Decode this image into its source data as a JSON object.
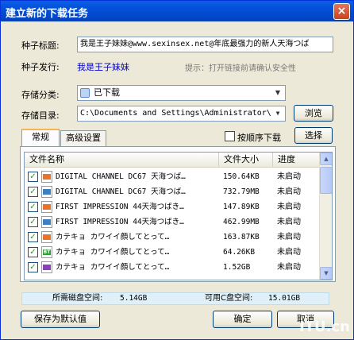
{
  "window": {
    "title": "建立新的下载任务",
    "close_glyph": "×"
  },
  "form": {
    "seed_title_label": "种子标题:",
    "seed_title_value": "我是王子妹妹@www.sexinsex.net@年底最强力的新人天海つば",
    "seed_publisher_label": "种子发行:",
    "seed_publisher_value": "我是王子妹妹",
    "hint": "提示：打开链接前请确认安全性",
    "category_label": "存储分类:",
    "category_value": "已下载",
    "directory_label": "存储目录:",
    "directory_value": "C:\\Documents and Settings\\Administrator\\",
    "browse_label": "浏览"
  },
  "tabs": [
    {
      "label": "常规",
      "active": true
    },
    {
      "label": "高级设置",
      "active": false
    }
  ],
  "sequential_label": "按顺序下载",
  "select_label": "选择",
  "file_list": {
    "columns": [
      "文件名称",
      "文件大小",
      "进度"
    ],
    "rows": [
      {
        "name": "DIGITAL CHANNEL DC67 天海つば…",
        "size": "150.64KB",
        "progress": "未启动",
        "icon": "image-file-icon",
        "color": "#e7732c",
        "tag": ""
      },
      {
        "name": "DIGITAL CHANNEL DC67 天海つば…",
        "size": "732.79MB",
        "progress": "未启动",
        "icon": "video-file-icon",
        "color": "#3f7fbf",
        "tag": ""
      },
      {
        "name": "FIRST IMPRESSION 44天海つばき…",
        "size": "147.89KB",
        "progress": "未启动",
        "icon": "image-file-icon",
        "color": "#e7732c",
        "tag": ""
      },
      {
        "name": "FIRST IMPRESSION 44天海つばき…",
        "size": "462.99MB",
        "progress": "未启动",
        "icon": "video-file-icon",
        "color": "#3f7fbf",
        "tag": ""
      },
      {
        "name": "カテキョ カワイイ顔してとって…",
        "size": "163.87KB",
        "progress": "未启动",
        "icon": "image-file-icon",
        "color": "#e7732c",
        "tag": ""
      },
      {
        "name": "カテキョ カワイイ顔してとって…",
        "size": "64.26KB",
        "progress": "未启动",
        "icon": "bt-file-icon",
        "color": "#2e9e3a",
        "tag": "BT"
      },
      {
        "name": "カテキョ カワイイ顔してとって…",
        "size": "1.52GB",
        "progress": "未启动",
        "icon": "video-file-icon",
        "color": "#8a3fbf",
        "tag": ""
      }
    ]
  },
  "status": {
    "disk_needed_label": "所需磁盘空间:",
    "disk_needed_value": "5.14GB",
    "c_free_label": "可用C盘空间:",
    "c_free_value": "15.01GB"
  },
  "buttons": {
    "save_default": "保存为默认值",
    "ok": "确定",
    "cancel": "取消"
  },
  "watermark": "ITU.cn"
}
